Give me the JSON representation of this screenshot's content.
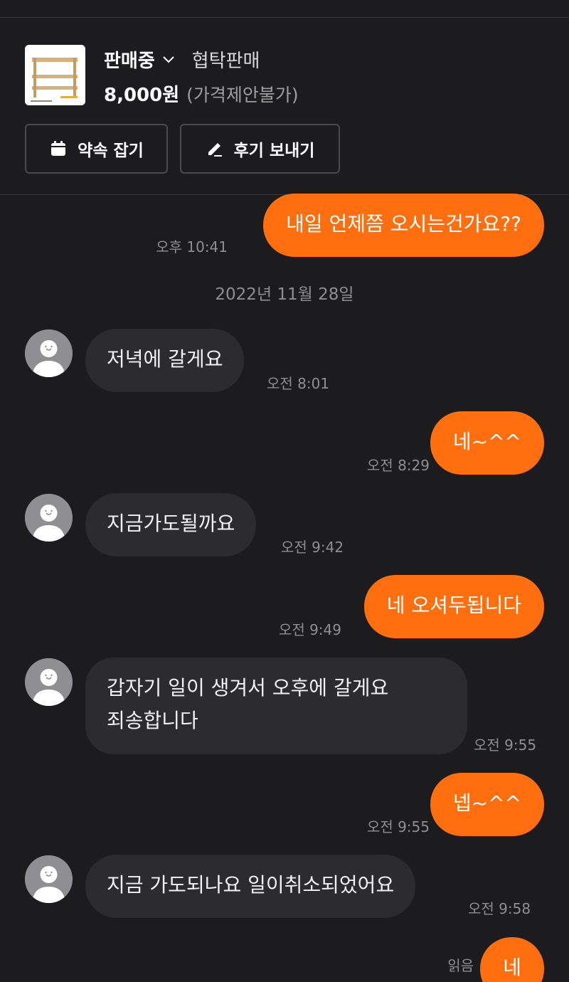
{
  "product": {
    "status_label": "판매중",
    "trade_type": "협탁판매",
    "price": "8,000원",
    "price_note": "(가격제안불가)",
    "appoint_button": "약속 잡기",
    "review_button": "후기 보내기"
  },
  "chat": {
    "date_separator": "2022년 11월 28일",
    "messages": [
      {
        "dir": "out",
        "text": "내일 언제쯤 오시는건가요??",
        "time": "오후 10:41"
      },
      {
        "dir": "in",
        "text": "저녁에 갈게요",
        "time": "오전 8:01"
      },
      {
        "dir": "out",
        "text": "네~^^",
        "time": "오전 8:29"
      },
      {
        "dir": "in",
        "text": "지금가도될까요",
        "time": "오전 9:42"
      },
      {
        "dir": "out",
        "text": "네 오셔두됩니다",
        "time": "오전 9:49"
      },
      {
        "dir": "in",
        "text_line1": "갑자기 일이 생겨서 오후에 갈게요",
        "text_line2": "죄송합니다",
        "time": "오전 9:55"
      },
      {
        "dir": "out",
        "text": "넵~^^",
        "time": "오전 9:55"
      },
      {
        "dir": "in",
        "text": "지금 가도되나요  일이취소되었어요",
        "time": "오전 9:58"
      },
      {
        "dir": "out",
        "text": "네",
        "time": "읽음"
      }
    ]
  },
  "colors": {
    "background": "#1c1c1e",
    "outgoing_bubble": "#ff6f0f",
    "incoming_bubble": "#2c2c2e",
    "timestamp": "#8e8e93"
  },
  "icons": {
    "dropdown": "chevron-down-icon",
    "appoint": "calendar-icon",
    "review": "pencil-icon",
    "avatar": "default-avatar-icon"
  }
}
